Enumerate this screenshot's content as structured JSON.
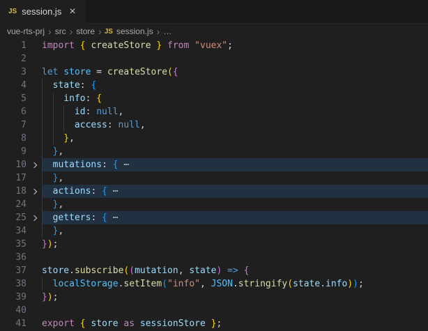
{
  "tab_bar": {
    "tabs": [
      {
        "icon": "JS",
        "title": "session.js",
        "close_label": "×"
      }
    ]
  },
  "breadcrumb": {
    "segments": [
      "vue-rts-prj",
      "src",
      "store"
    ],
    "separator": "›",
    "file": {
      "icon": "JS",
      "name": "session.js"
    },
    "tail": "…"
  },
  "ui_colors": {
    "editor_bg": "#1f1f1f",
    "tab_strip_bg": "#181818",
    "active_tab_bg": "#1f1f1f",
    "line_number": "#6e7681",
    "breadcrumb_text": "#a9a9a9",
    "js_icon": "#d7ba4a",
    "fold_highlight": "rgba(38,79,120,0.38)"
  },
  "editor": {
    "colors": {
      "kw": "#c586c0",
      "kwb": "#569cd6",
      "fn": "#dcdcaa",
      "var": "#9cdcfe",
      "decl": "#4fc1ff",
      "str": "#ce9178",
      "b1": "#ffd700",
      "b2": "#da70d6",
      "b3": "#179fff",
      "punc": "#d4d4d4",
      "fold": "#c8c8c8"
    },
    "lines": [
      {
        "num": 1,
        "indent": 0,
        "tokens": [
          [
            "import",
            "kw"
          ],
          [
            " ",
            "punc"
          ],
          [
            "{",
            "b1"
          ],
          [
            " createStore ",
            "fn"
          ],
          [
            "}",
            "b1"
          ],
          [
            " ",
            "punc"
          ],
          [
            "from",
            "kw"
          ],
          [
            " ",
            "punc"
          ],
          [
            "\"vuex\"",
            "str"
          ],
          [
            ";",
            "punc"
          ]
        ]
      },
      {
        "num": 2,
        "indent": 0,
        "tokens": []
      },
      {
        "num": 3,
        "indent": 0,
        "tokens": [
          [
            "let",
            "kwb"
          ],
          [
            " ",
            "punc"
          ],
          [
            "store",
            "decl"
          ],
          [
            " = ",
            "punc"
          ],
          [
            "createStore",
            "fn"
          ],
          [
            "(",
            "b1"
          ],
          [
            "{",
            "b2"
          ]
        ]
      },
      {
        "num": 4,
        "indent": 1,
        "tokens": [
          [
            "state",
            "var"
          ],
          [
            ": ",
            "punc"
          ],
          [
            "{",
            "b3"
          ]
        ]
      },
      {
        "num": 5,
        "indent": 2,
        "tokens": [
          [
            "info",
            "var"
          ],
          [
            ": ",
            "punc"
          ],
          [
            "{",
            "b1"
          ]
        ]
      },
      {
        "num": 6,
        "indent": 3,
        "tokens": [
          [
            "id",
            "var"
          ],
          [
            ": ",
            "punc"
          ],
          [
            "null",
            "kwb"
          ],
          [
            ",",
            "punc"
          ]
        ]
      },
      {
        "num": 7,
        "indent": 3,
        "tokens": [
          [
            "access",
            "var"
          ],
          [
            ": ",
            "punc"
          ],
          [
            "null",
            "kwb"
          ],
          [
            ",",
            "punc"
          ]
        ]
      },
      {
        "num": 8,
        "indent": 2,
        "tokens": [
          [
            "}",
            "b1"
          ],
          [
            ",",
            "punc"
          ]
        ]
      },
      {
        "num": 9,
        "indent": 1,
        "tokens": [
          [
            "}",
            "b3"
          ],
          [
            ",",
            "punc"
          ]
        ]
      },
      {
        "num": 10,
        "indent": 1,
        "folded": true,
        "tokens": [
          [
            "mutations",
            "var"
          ],
          [
            ": ",
            "punc"
          ],
          [
            "{",
            "b3"
          ],
          [
            " ",
            "punc"
          ],
          [
            "⋯",
            "fold"
          ]
        ]
      },
      {
        "num": 17,
        "indent": 1,
        "tokens": [
          [
            "}",
            "b3"
          ],
          [
            ",",
            "punc"
          ]
        ]
      },
      {
        "num": 18,
        "indent": 1,
        "folded": true,
        "tokens": [
          [
            "actions",
            "var"
          ],
          [
            ": ",
            "punc"
          ],
          [
            "{",
            "b3"
          ],
          [
            " ",
            "punc"
          ],
          [
            "⋯",
            "fold"
          ]
        ]
      },
      {
        "num": 24,
        "indent": 1,
        "tokens": [
          [
            "}",
            "b3"
          ],
          [
            ",",
            "punc"
          ]
        ]
      },
      {
        "num": 25,
        "indent": 1,
        "folded": true,
        "tokens": [
          [
            "getters",
            "var"
          ],
          [
            ": ",
            "punc"
          ],
          [
            "{",
            "b3"
          ],
          [
            " ",
            "punc"
          ],
          [
            "⋯",
            "fold"
          ]
        ]
      },
      {
        "num": 34,
        "indent": 1,
        "tokens": [
          [
            "}",
            "b3"
          ],
          [
            ",",
            "punc"
          ]
        ]
      },
      {
        "num": 35,
        "indent": 0,
        "tokens": [
          [
            "}",
            "b2"
          ],
          [
            ")",
            "b1"
          ],
          [
            ";",
            "punc"
          ]
        ]
      },
      {
        "num": 36,
        "indent": 0,
        "tokens": []
      },
      {
        "num": 37,
        "indent": 0,
        "tokens": [
          [
            "store",
            "var"
          ],
          [
            ".",
            "punc"
          ],
          [
            "subscribe",
            "fn"
          ],
          [
            "(",
            "b1"
          ],
          [
            "(",
            "b2"
          ],
          [
            "mutation",
            "var"
          ],
          [
            ", ",
            "punc"
          ],
          [
            "state",
            "var"
          ],
          [
            ")",
            "b2"
          ],
          [
            " ",
            "punc"
          ],
          [
            "=>",
            "kwb"
          ],
          [
            " ",
            "punc"
          ],
          [
            "{",
            "b2"
          ]
        ]
      },
      {
        "num": 38,
        "indent": 1,
        "tokens": [
          [
            "localStorage",
            "decl"
          ],
          [
            ".",
            "punc"
          ],
          [
            "setItem",
            "fn"
          ],
          [
            "(",
            "b3"
          ],
          [
            "\"info\"",
            "str"
          ],
          [
            ", ",
            "punc"
          ],
          [
            "JSON",
            "decl"
          ],
          [
            ".",
            "punc"
          ],
          [
            "stringify",
            "fn"
          ],
          [
            "(",
            "b1"
          ],
          [
            "state",
            "var"
          ],
          [
            ".",
            "punc"
          ],
          [
            "info",
            "var"
          ],
          [
            ")",
            "b1"
          ],
          [
            ")",
            "b3"
          ],
          [
            ";",
            "punc"
          ]
        ]
      },
      {
        "num": 39,
        "indent": 0,
        "tokens": [
          [
            "}",
            "b2"
          ],
          [
            ")",
            "b1"
          ],
          [
            ";",
            "punc"
          ]
        ]
      },
      {
        "num": 40,
        "indent": 0,
        "tokens": []
      },
      {
        "num": 41,
        "indent": 0,
        "tokens": [
          [
            "export",
            "kw"
          ],
          [
            " ",
            "punc"
          ],
          [
            "{",
            "b1"
          ],
          [
            " ",
            "punc"
          ],
          [
            "store",
            "var"
          ],
          [
            " ",
            "punc"
          ],
          [
            "as",
            "kw"
          ],
          [
            " ",
            "punc"
          ],
          [
            "sessionStore",
            "var"
          ],
          [
            " ",
            "punc"
          ],
          [
            "}",
            "b1"
          ],
          [
            ";",
            "punc"
          ]
        ]
      }
    ]
  }
}
